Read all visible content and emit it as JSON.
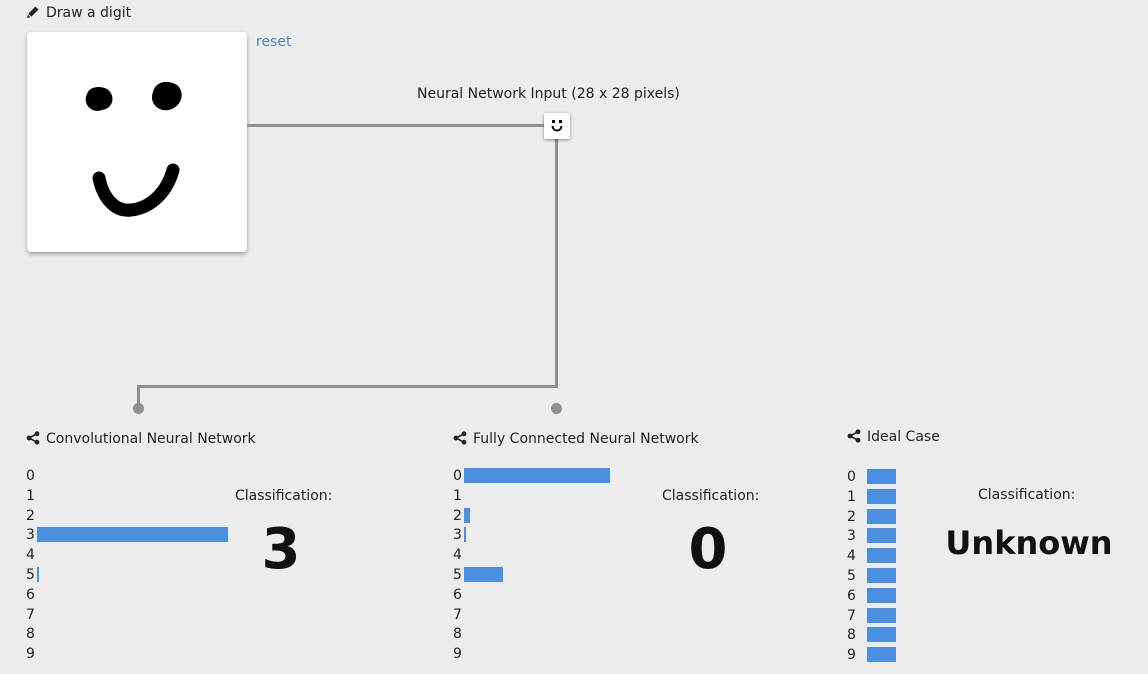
{
  "draw": {
    "title": "Draw a digit",
    "reset_label": "reset"
  },
  "input_section": {
    "title": "Neural Network Input (28 x 28 pixels)"
  },
  "networks": [
    {
      "title": "Convolutional Neural Network",
      "classification_label": "Classification:",
      "classification": "3",
      "digits": [
        "0",
        "1",
        "2",
        "3",
        "4",
        "5",
        "6",
        "7",
        "8",
        "9"
      ],
      "probabilities": [
        0,
        0,
        0,
        0.98,
        0,
        0.01,
        0,
        0,
        0,
        0
      ]
    },
    {
      "title": "Fully Connected Neural Network",
      "classification_label": "Classification:",
      "classification": "0",
      "digits": [
        "0",
        "1",
        "2",
        "3",
        "4",
        "5",
        "6",
        "7",
        "8",
        "9"
      ],
      "probabilities": [
        0.75,
        0,
        0.03,
        0.01,
        0,
        0.2,
        0,
        0,
        0,
        0
      ]
    },
    {
      "title": "Ideal Case",
      "classification_label": "Classification:",
      "classification": "Unknown",
      "digits": [
        "0",
        "1",
        "2",
        "3",
        "4",
        "5",
        "6",
        "7",
        "8",
        "9"
      ],
      "probabilities": [
        0.1,
        0.1,
        0.1,
        0.1,
        0.1,
        0.1,
        0.1,
        0.1,
        0.1,
        0.1
      ]
    }
  ],
  "colors": {
    "bar": "#4a8fe0",
    "connector": "#8f8f8f",
    "link": "#4a86c6",
    "background": "#ececec"
  }
}
